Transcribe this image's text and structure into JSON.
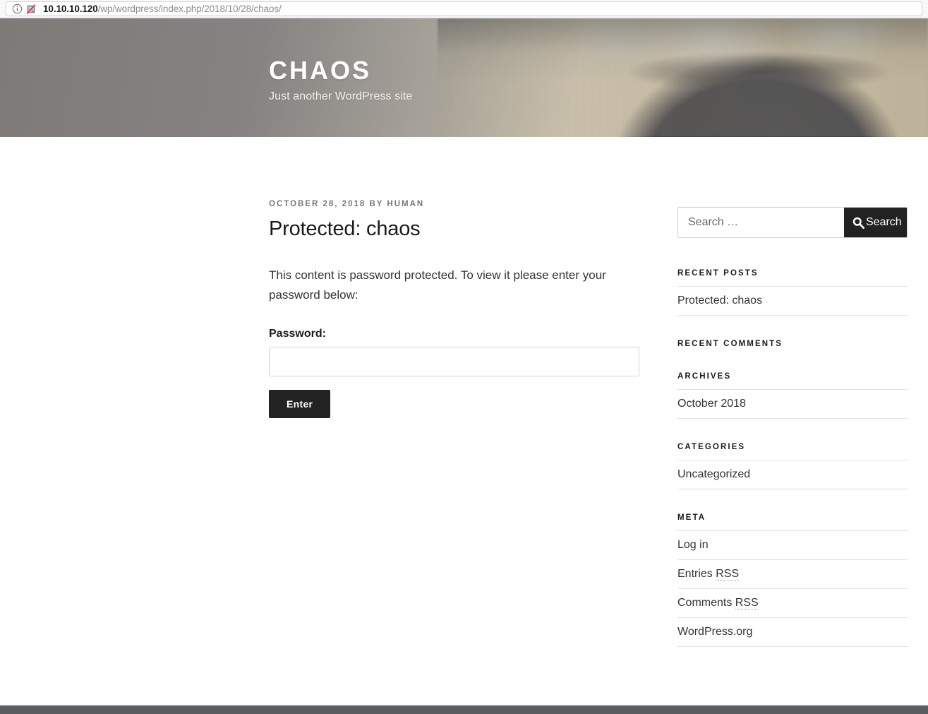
{
  "browser": {
    "url_host": "10.10.10.120",
    "url_path": "/wp/wordpress/index.php/2018/10/28/chaos/",
    "info_icon": "info-circle-icon",
    "reader_icon": "reader-mode-disabled-icon"
  },
  "header": {
    "site_title": "CHAOS",
    "tagline": "Just another WordPress site"
  },
  "post": {
    "meta_date": "OCTOBER 28, 2018",
    "meta_by": "BY",
    "meta_author": "HUMAN",
    "meta_full": "OCTOBER 28, 2018 BY HUMAN",
    "title": "Protected: chaos",
    "intro": "This content is password protected. To view it please enter your password below:",
    "password_label": "Password:",
    "password_value": "",
    "password_placeholder": "",
    "submit_label": "Enter"
  },
  "sidebar": {
    "search": {
      "placeholder": "Search …",
      "value": "",
      "button_label": "Search",
      "button_icon": "search-icon"
    },
    "widgets": [
      {
        "title": "Recent Posts",
        "items": [
          "Protected: chaos"
        ]
      },
      {
        "title": "Recent Comments",
        "items": []
      },
      {
        "title": "Archives",
        "items": [
          "October 2018"
        ]
      },
      {
        "title": "Categories",
        "items": [
          "Uncategorized"
        ]
      },
      {
        "title": "Meta",
        "items": [
          "Log in",
          "Entries RSS",
          "Comments RSS",
          "WordPress.org"
        ]
      }
    ],
    "meta_items": [
      {
        "text": "Log in",
        "abbr": ""
      },
      {
        "text": "Entries ",
        "abbr": "RSS"
      },
      {
        "text": "Comments ",
        "abbr": "RSS"
      },
      {
        "text": "WordPress.org",
        "abbr": ""
      }
    ]
  },
  "colors": {
    "accent_dark": "#222222",
    "text": "#333333",
    "meta_gray": "#767676",
    "border": "#e3e3e3"
  }
}
